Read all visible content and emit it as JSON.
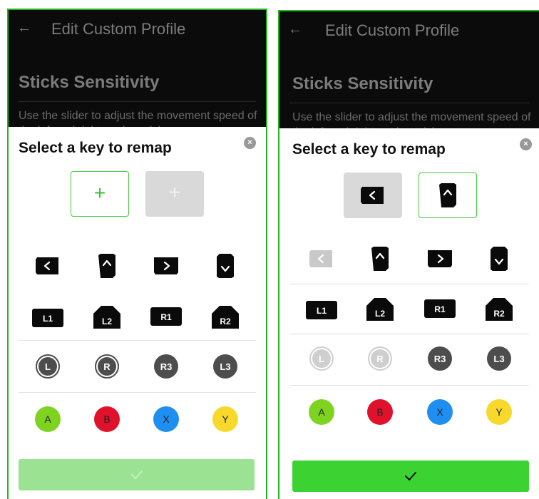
{
  "header": {
    "back_icon": "←",
    "title": "Edit Custom Profile"
  },
  "section": {
    "title": "Sticks Sensitivity",
    "description": "Use the slider to adjust the movement speed of the left and right analog sticks."
  },
  "sheet": {
    "title": "Select a key to remap",
    "close_icon": "×"
  },
  "slots": {
    "plus": "+"
  },
  "keys": {
    "dpad": [
      "dpad-left",
      "dpad-up",
      "dpad-right",
      "dpad-down"
    ],
    "shoulders": [
      "L1",
      "L2",
      "R1",
      "R2"
    ],
    "sticks": [
      "L",
      "R",
      "R3",
      "L3"
    ],
    "face": [
      {
        "label": "A",
        "color": "#7ed321"
      },
      {
        "label": "B",
        "color": "#e0112b"
      },
      {
        "label": "X",
        "color": "#1e8ef0"
      },
      {
        "label": "Y",
        "color": "#f8d92b"
      }
    ]
  },
  "colors": {
    "accent": "#3cd232",
    "accent_disabled": "#9be392",
    "panel_border": "#22b51c"
  }
}
